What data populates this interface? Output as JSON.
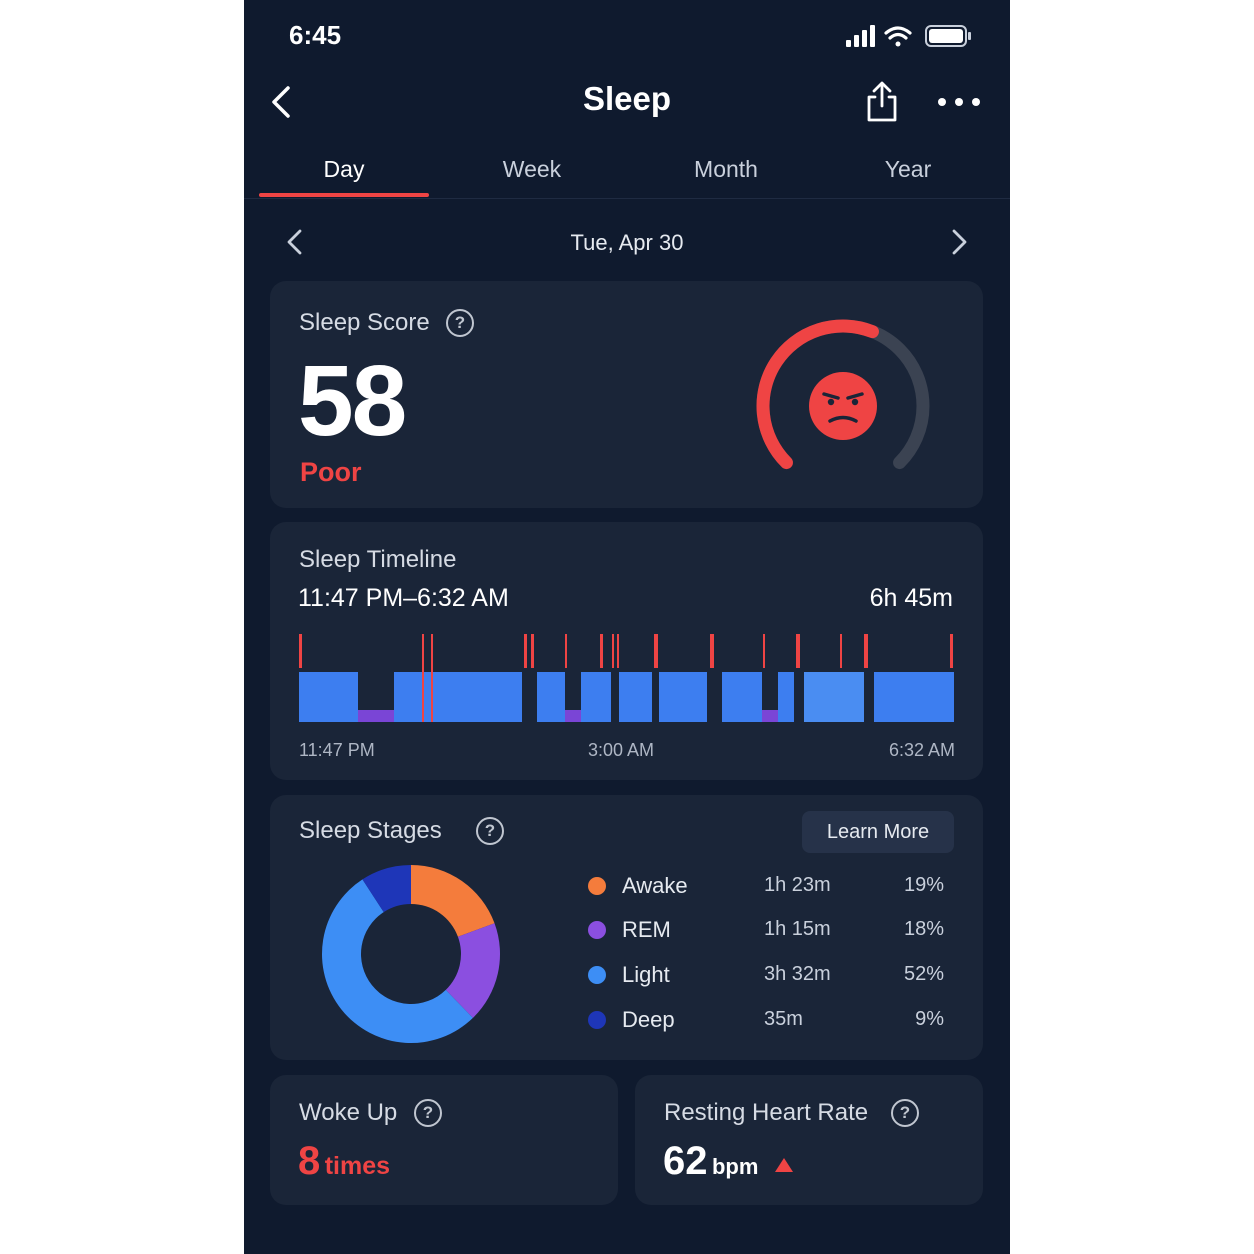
{
  "status": {
    "time": "6:45"
  },
  "nav": {
    "title": "Sleep"
  },
  "tabs": [
    {
      "label": "Day",
      "active": true
    },
    {
      "label": "Week",
      "active": false
    },
    {
      "label": "Month",
      "active": false
    },
    {
      "label": "Year",
      "active": false
    }
  ],
  "date": {
    "label": "Tue, Apr 30"
  },
  "score": {
    "title": "Sleep Score",
    "value": "58",
    "rating": "Poor",
    "max": 100,
    "accent": "#ef4444",
    "track": "#3b4352"
  },
  "timeline": {
    "title": "Sleep Timeline",
    "range": "11:47 PM–6:32 AM",
    "duration": "6h 45m",
    "axis": [
      "11:47 PM",
      "3:00 AM",
      "6:32 AM"
    ]
  },
  "stages": {
    "title": "Sleep Stages",
    "learn_more": "Learn More",
    "items": [
      {
        "name": "Awake",
        "duration": "1h 23m",
        "percent": "19%",
        "value": 19,
        "color": "#f47c3c"
      },
      {
        "name": "REM",
        "duration": "1h 15m",
        "percent": "18%",
        "value": 18,
        "color": "#8b4fe0"
      },
      {
        "name": "Light",
        "duration": "3h 32m",
        "percent": "52%",
        "value": 52,
        "color": "#3d8ef5"
      },
      {
        "name": "Deep",
        "duration": "35m",
        "percent": "9%",
        "value": 9,
        "color": "#1e36b8"
      }
    ]
  },
  "woke": {
    "title": "Woke Up",
    "value": "8",
    "unit": "times"
  },
  "heart": {
    "title": "Resting Heart Rate",
    "value": "62",
    "unit": "bpm",
    "trend": "up"
  }
}
